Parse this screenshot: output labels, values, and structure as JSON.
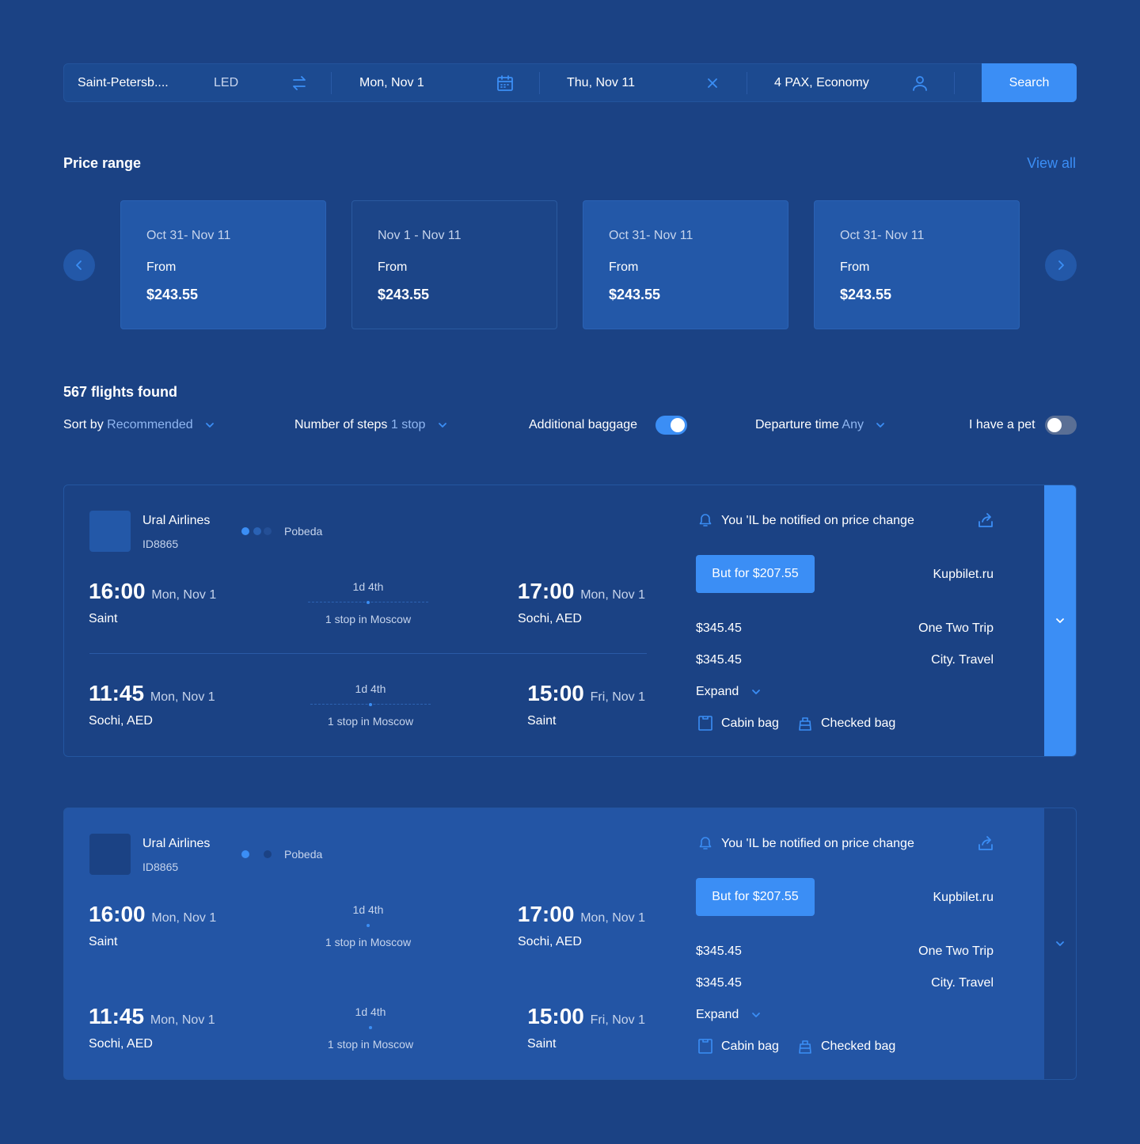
{
  "search": {
    "from_city": "Saint-Petersb....",
    "from_code": "LED",
    "depart_date": "Mon, Nov 1",
    "return_date": "Thu, Nov 11",
    "passengers": "4 PAX, Economy",
    "search_label": "Search"
  },
  "price_range": {
    "title": "Price range",
    "view_all": "View all",
    "cards": [
      {
        "dates": "Oct 31- Nov 11",
        "from": "From",
        "price": "$243.55"
      },
      {
        "dates": "Nov 1 - Nov 11",
        "from": "From",
        "price": "$243.55"
      },
      {
        "dates": "Oct 31- Nov 11",
        "from": "From",
        "price": "$243.55"
      },
      {
        "dates": "Oct 31- Nov 11",
        "from": "From",
        "price": "$243.55"
      }
    ]
  },
  "results": {
    "count_title": "567 flights found",
    "filters": {
      "sort_label": "Sort by",
      "sort_value": "Recommended",
      "steps_label": "Number of steps",
      "steps_value": "1 stop",
      "baggage_label": "Additional baggage",
      "baggage_on": true,
      "departure_label": "Departure time",
      "departure_value": "Any",
      "pet_label": "I have a pet",
      "pet_on": false
    }
  },
  "flights": [
    {
      "airline": "Ural Airlines",
      "flight_id": "ID8865",
      "partner": "Pobeda",
      "outbound": {
        "dep_time": "16:00",
        "dep_date": "Mon, Nov 1",
        "dep_place": "Saint",
        "duration": "1d 4th",
        "stops": "1 stop in Moscow",
        "arr_time": "17:00",
        "arr_date": "Mon, Nov 1",
        "arr_place": "Sochi, AED"
      },
      "inbound": {
        "dep_time": "11:45",
        "dep_date": "Mon, Nov 1",
        "dep_place": "Sochi, AED",
        "duration": "1d 4th",
        "stops": "1 stop in Moscow",
        "arr_time": "15:00",
        "arr_date": "Fri, Nov 1",
        "arr_place": "Saint"
      },
      "notify": "You 'IL be notified on price change",
      "buy_label": "But for $207.55",
      "buy_vendor": "Kupbilet.ru",
      "offers": [
        {
          "price": "$345.45",
          "vendor": "One Two Trip"
        },
        {
          "price": "$345.45",
          "vendor": "City. Travel"
        }
      ],
      "expand": "Expand",
      "cabin_bag": "Cabin bag",
      "checked_bag": "Checked bag"
    },
    {
      "airline": "Ural Airlines",
      "flight_id": "ID8865",
      "partner": "Pobeda",
      "outbound": {
        "dep_time": "16:00",
        "dep_date": "Mon, Nov 1",
        "dep_place": "Saint",
        "duration": "1d 4th",
        "stops": "1 stop in Moscow",
        "arr_time": "17:00",
        "arr_date": "Mon, Nov 1",
        "arr_place": "Sochi, AED"
      },
      "inbound": {
        "dep_time": "11:45",
        "dep_date": "Mon, Nov 1",
        "dep_place": "Sochi, AED",
        "duration": "1d 4th",
        "stops": "1 stop in Moscow",
        "arr_time": "15:00",
        "arr_date": "Fri, Nov 1",
        "arr_place": "Saint"
      },
      "notify": "You 'IL be notified on price change",
      "buy_label": "But for $207.55",
      "buy_vendor": "Kupbilet.ru",
      "offers": [
        {
          "price": "$345.45",
          "vendor": "One Two Trip"
        },
        {
          "price": "$345.45",
          "vendor": "City. Travel"
        }
      ],
      "expand": "Expand",
      "cabin_bag": "Cabin bag",
      "checked_bag": "Checked bag"
    }
  ],
  "colors": {
    "background": "#1b4284",
    "accent": "#3b8ef5",
    "card": "#2358a8"
  }
}
